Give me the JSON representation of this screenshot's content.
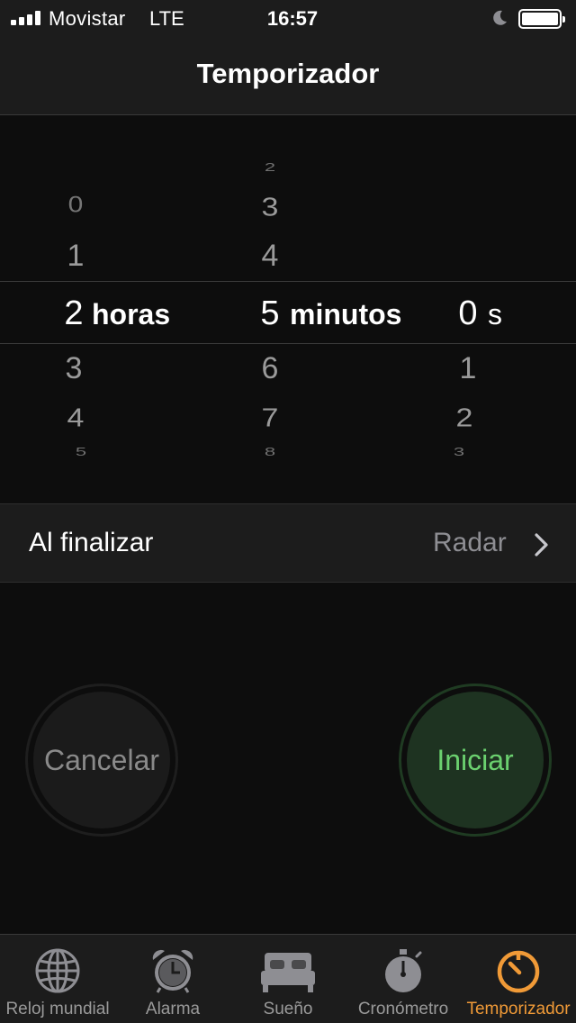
{
  "status_bar": {
    "carrier": "Movistar",
    "network": "LTE",
    "time": "16:57"
  },
  "nav": {
    "title": "Temporizador"
  },
  "picker": {
    "hours": {
      "above": [
        "0",
        "1"
      ],
      "selected": "2",
      "below": [
        "3",
        "4",
        "5"
      ],
      "unit": "horas"
    },
    "minutes": {
      "above": [
        "2",
        "3",
        "4"
      ],
      "selected": "5",
      "below": [
        "6",
        "7",
        "8"
      ],
      "unit": "minutos"
    },
    "seconds": {
      "selected": "0",
      "below": [
        "1",
        "2",
        "3"
      ],
      "unit": "s"
    }
  },
  "when_done": {
    "label": "Al finalizar",
    "value": "Radar"
  },
  "buttons": {
    "cancel": "Cancelar",
    "start": "Iniciar"
  },
  "tabs": [
    {
      "label": "Reloj mundial",
      "icon": "globe-icon"
    },
    {
      "label": "Alarma",
      "icon": "alarm-clock-icon"
    },
    {
      "label": "Sueño",
      "icon": "bed-icon"
    },
    {
      "label": "Cronómetro",
      "icon": "stopwatch-icon"
    },
    {
      "label": "Temporizador",
      "icon": "timer-icon",
      "active": true
    }
  ],
  "colors": {
    "accent": "#f09a37",
    "start_green": "#6bd16f",
    "background": "#0d0d0d",
    "bar": "#1c1c1c"
  }
}
